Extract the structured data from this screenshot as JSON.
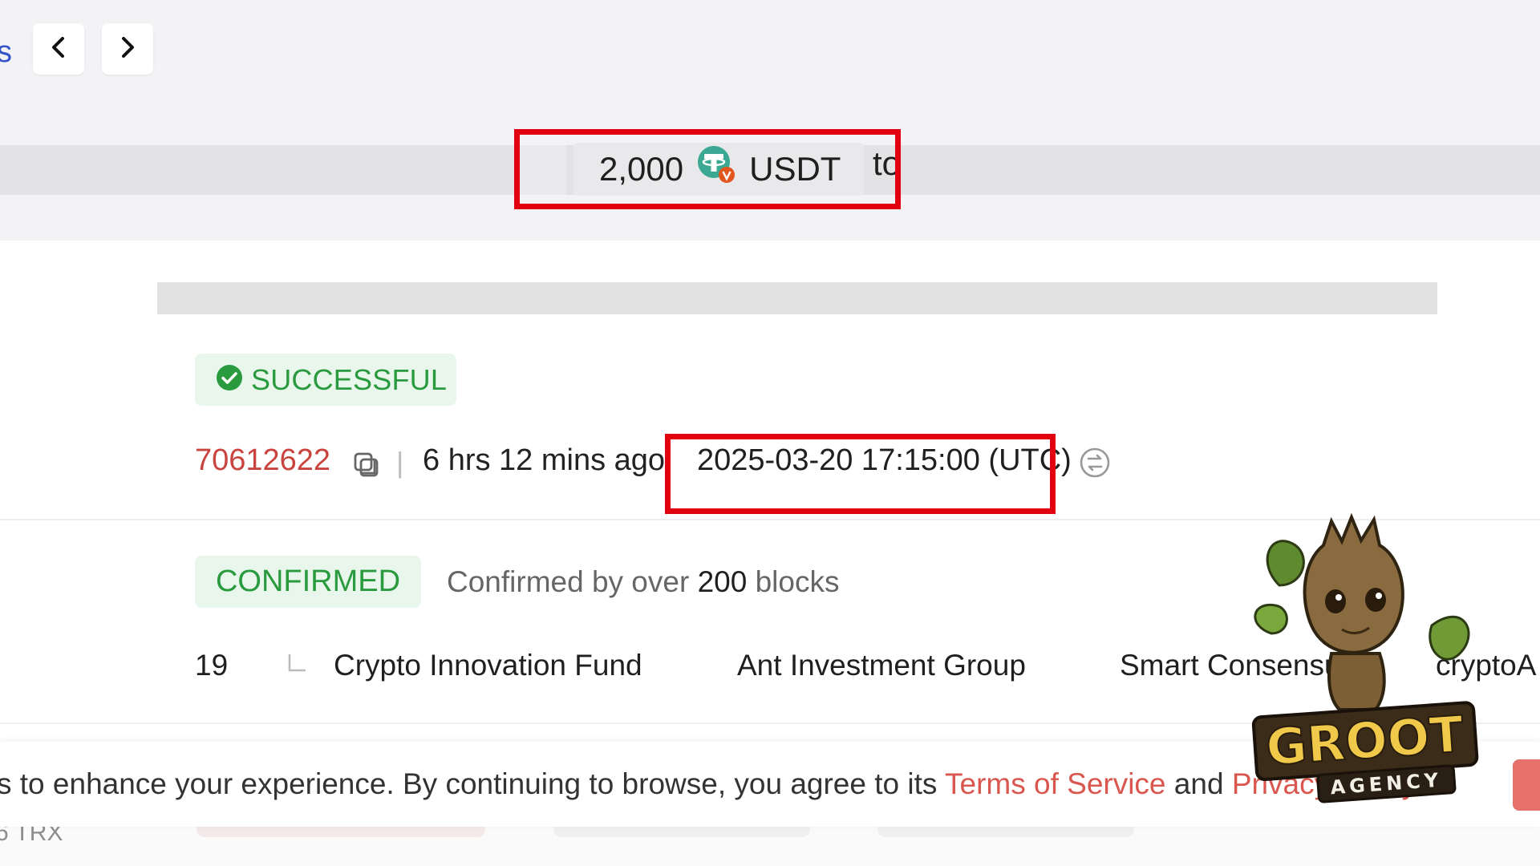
{
  "header": {
    "left_fragment": "s",
    "back_label": "back",
    "forward_label": "forward"
  },
  "summary": {
    "amount": "2,000",
    "token": "USDT",
    "to_fragment": "to"
  },
  "status": {
    "result": "SUCCESSFUL",
    "block_number": "70612622",
    "age": "6 hrs 12 mins ago",
    "separator": "|",
    "timestamp": "2025-03-20 17:15:00 (UTC)"
  },
  "confirmation": {
    "badge": "CONFIRMED",
    "desc_prefix": "Confirmed by over",
    "desc_count": "200",
    "desc_suffix": "blocks"
  },
  "super_representatives": {
    "count": "19",
    "names": [
      "Crypto Innovation Fund",
      "Ant Investment Group",
      "Smart Consensus",
      "cryptoA"
    ]
  },
  "cookie": {
    "text_before": "s to enhance your experience. By continuing to browse, you agree to its",
    "terms_link": "Terms of Service",
    "and_text": "and",
    "privacy_link": "Privacy Policy."
  },
  "footer": {
    "trx_fragment": "6 TRX"
  },
  "watermark": {
    "line1": "GROOT",
    "line2": "AGENCY"
  },
  "colors": {
    "success_green": "#2a9a3e",
    "link_red": "#c9443f",
    "highlight_red": "#e10010",
    "tether_green": "#3aa892"
  },
  "icons": [
    "chevron-left-icon",
    "chevron-right-icon",
    "tether-token-icon",
    "check-circle-icon",
    "copy-icon",
    "clock-convert-icon",
    "sr-indent-icon"
  ]
}
